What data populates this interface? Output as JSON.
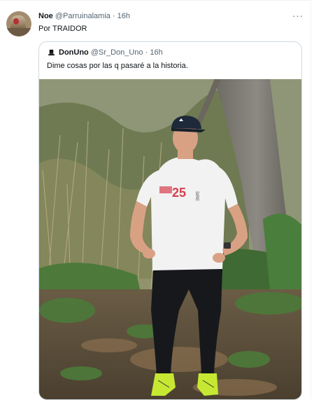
{
  "tweet": {
    "author_name": "Noe",
    "handle": "@Parruinalamia",
    "separator": "·",
    "time": "16h",
    "text": "Por TRAIDOR",
    "more_glyph": "···"
  },
  "quoted_tweet": {
    "author_name": "DonUno",
    "handle": "@Sr_Don_Uno",
    "separator": "·",
    "time": "16h",
    "text": "Dime cosas por las q pasaré a la historia.",
    "photo_shirt_text": "25 SIRE"
  },
  "icons": {
    "more": "more-horizontal-icon",
    "quoted_avatar": "top-hat-icon"
  },
  "colors": {
    "text_primary": "#0f1419",
    "text_secondary": "#536471",
    "border": "#cfd9de"
  }
}
